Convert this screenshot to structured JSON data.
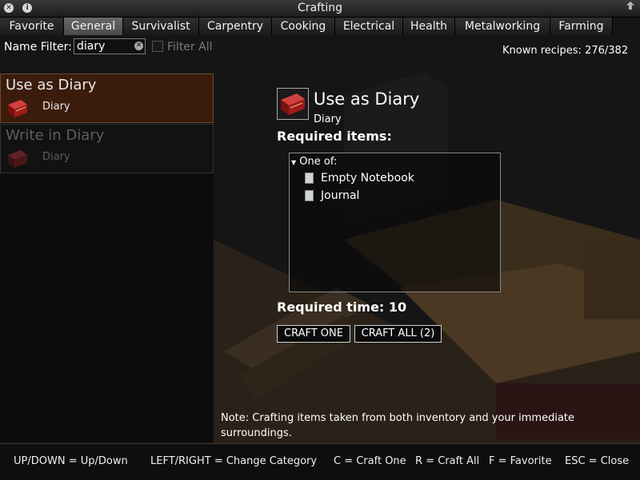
{
  "window": {
    "title": "Crafting"
  },
  "tabs": [
    {
      "label": "Favorite"
    },
    {
      "label": "General"
    },
    {
      "label": "Survivalist"
    },
    {
      "label": "Carpentry"
    },
    {
      "label": "Cooking"
    },
    {
      "label": "Electrical"
    },
    {
      "label": "Health"
    },
    {
      "label": "Metalworking"
    },
    {
      "label": "Farming"
    }
  ],
  "active_tab": "General",
  "filter": {
    "label": "Name Filter:",
    "value": "diary",
    "filter_all_label": "Filter All",
    "filter_all_checked": false
  },
  "known_recipes": {
    "label": "Known recipes:",
    "value": "276/382"
  },
  "recipes": [
    {
      "title": "Use as Diary",
      "subtitle": "Diary",
      "selected": true,
      "enabled": true
    },
    {
      "title": "Write in Diary",
      "subtitle": "Diary",
      "selected": false,
      "enabled": false
    }
  ],
  "detail": {
    "title": "Use as Diary",
    "subtitle": "Diary",
    "required_items_label": "Required items:",
    "one_of_label": "One of:",
    "items": [
      {
        "name": "Empty Notebook",
        "icon": "notebook-icon"
      },
      {
        "name": "Journal",
        "icon": "journal-icon"
      }
    ],
    "required_time": "Required time: 10",
    "craft_one_label": "CRAFT ONE",
    "craft_all_label": "CRAFT ALL (2)"
  },
  "note": "Note: Crafting items taken from both inventory and your immediate surroundings.",
  "footer": {
    "hints": [
      "UP/DOWN = Up/Down",
      "LEFT/RIGHT = Change Category",
      "C = Craft One",
      "R = Craft All",
      "F = Favorite",
      "ESC = Close"
    ]
  },
  "colors": {
    "selected_recipe_bg": "#3b1c0c",
    "book_red": "#a01c1c"
  }
}
